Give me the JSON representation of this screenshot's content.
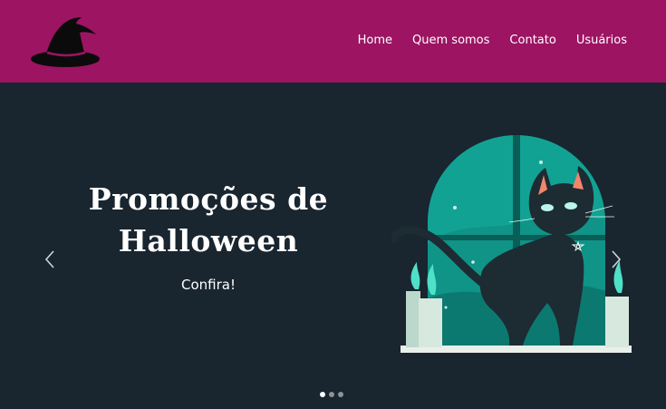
{
  "nav": {
    "logo_icon": "witch-hat-icon",
    "items": [
      {
        "label": "Home"
      },
      {
        "label": "Quem somos"
      },
      {
        "label": "Contato"
      },
      {
        "label": "Usuários"
      }
    ]
  },
  "carousel": {
    "slide": {
      "title_line1": "Promoções de",
      "title_line2": "Halloween",
      "subtitle": "Confira!",
      "image_icon": "black-cat-moon-illustration"
    },
    "prev_icon": "chevron-left-icon",
    "next_icon": "chevron-right-icon",
    "indicators_count": 3,
    "active_index": 0
  },
  "colors": {
    "navbar_bg": "#9c1462",
    "hero_bg": "#19252f",
    "accent_teal": "#1ab5a3"
  }
}
